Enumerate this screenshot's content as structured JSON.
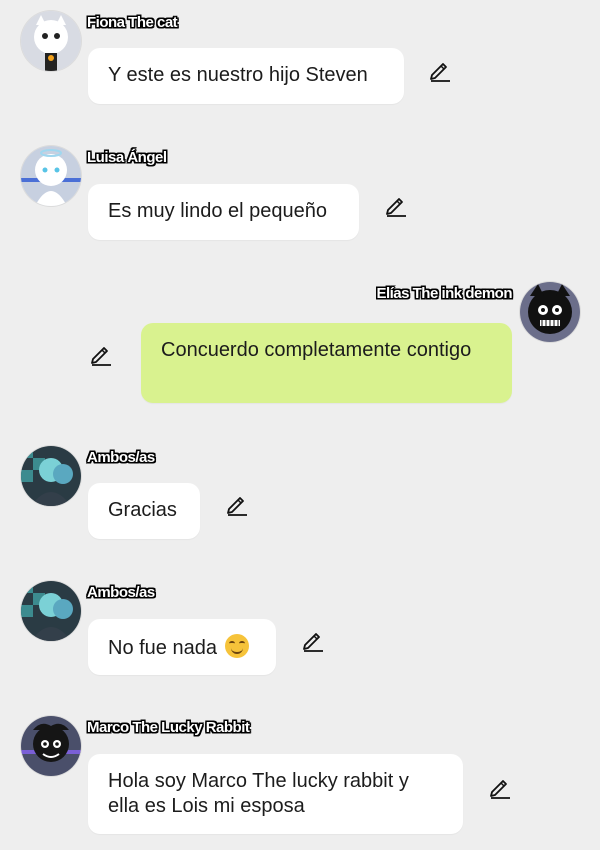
{
  "messages": [
    {
      "author": "Fiona The cat",
      "text": "Y este es nuestro hijo Steven",
      "outgoing": false,
      "avatar_icon": "white-cat-avatar"
    },
    {
      "author": "Luisa Ángel",
      "text": "Es muy lindo el pequeño",
      "outgoing": false,
      "avatar_icon": "angel-avatar"
    },
    {
      "author": "Elías The ink demon",
      "text": "Concuerdo completamente contigo",
      "outgoing": true,
      "avatar_icon": "ink-demon-avatar"
    },
    {
      "author": "Ambos/as",
      "text": "Gracias",
      "outgoing": false,
      "avatar_icon": "couple-avatar"
    },
    {
      "author": "Ambos/as",
      "text": "No fue nada",
      "emoji": "smiling-face-emoji",
      "outgoing": false,
      "avatar_icon": "couple-avatar"
    },
    {
      "author": "Marco The Lucky Rabbit",
      "text": "Hola soy Marco The lucky rabbit y ella es Lois mi esposa",
      "outgoing": false,
      "avatar_icon": "rabbit-avatar"
    }
  ],
  "colors": {
    "background": "#eeeeee",
    "incoming_bubble": "#ffffff",
    "outgoing_bubble": "#d9f28f",
    "text": "#1c1c1c"
  },
  "icons": {
    "edit": "pencil-edit-icon"
  }
}
